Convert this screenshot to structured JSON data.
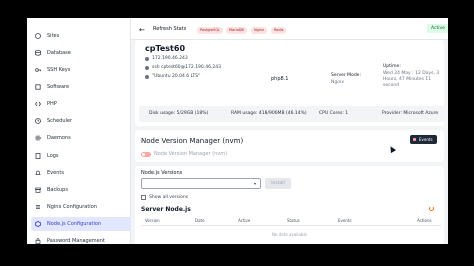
{
  "sidebar": {
    "items": [
      {
        "label": "Sites",
        "icon": "globe-icon",
        "active": false
      },
      {
        "label": "Database",
        "icon": "database-icon",
        "active": false
      },
      {
        "label": "SSH Keys",
        "icon": "key-icon",
        "active": false
      },
      {
        "label": "Software",
        "icon": "cube-icon",
        "active": false
      },
      {
        "label": "PHP",
        "icon": "code-icon",
        "active": false
      },
      {
        "label": "Scheduler",
        "icon": "clock-icon",
        "active": false
      },
      {
        "label": "Daemons",
        "icon": "cog-icon",
        "active": false
      },
      {
        "label": "Logs",
        "icon": "document-icon",
        "active": false
      },
      {
        "label": "Events",
        "icon": "bell-icon",
        "active": false
      },
      {
        "label": "Backups",
        "icon": "archive-icon",
        "active": false
      },
      {
        "label": "Nginx Configuration",
        "icon": "settings-icon",
        "active": false
      },
      {
        "label": "Node.js Configuration",
        "icon": "node-icon",
        "active": true
      },
      {
        "label": "Password Management",
        "icon": "lock-icon",
        "active": false
      }
    ]
  },
  "topbar": {
    "back_icon": "arrow-left-icon",
    "refresh_label": "Refresh Stats",
    "tags": [
      "PostgreSQL",
      "MariaDB",
      "Nginx",
      "Redis"
    ],
    "status": "Active"
  },
  "server": {
    "name": "cpTest60",
    "ip": "172.190.46.243",
    "ssh": "ssh cptest60@172.190.46.243",
    "os": "\"Ubuntu 20.04.6 LTS\"",
    "php": "php8.1",
    "mode_label": "Server Mode:",
    "mode_value": "Nginx",
    "uptime_label": "Uptime:",
    "uptime_value": "Wed 24 May : 12 Days, 3 Hours, 47 Minutes 11 second",
    "disk": "Disk usage: 5/29GB (18%)",
    "ram": "RAM usage: 418/906MB (46.14%)",
    "cpu": "CPU Cores: 1",
    "provider": "Provider: Microsoft Azure"
  },
  "nvm": {
    "title": "Node Version Manager (nvm)",
    "toggle_label": "Node Version Manager (nvm)",
    "events_label": "Events"
  },
  "node": {
    "versions_label": "Node.js Versions",
    "select_value": "",
    "install_label": "Install",
    "show_all_label": "Show all versions",
    "server_title": "Server Node.js",
    "columns": [
      "Version",
      "Date",
      "Active",
      "Status",
      "Events",
      "Actions"
    ],
    "no_data": "No data available"
  },
  "colors": {
    "accent": "#4338ca",
    "active_badge": "#dcfce7",
    "tag_bg": "#fee2e2"
  }
}
